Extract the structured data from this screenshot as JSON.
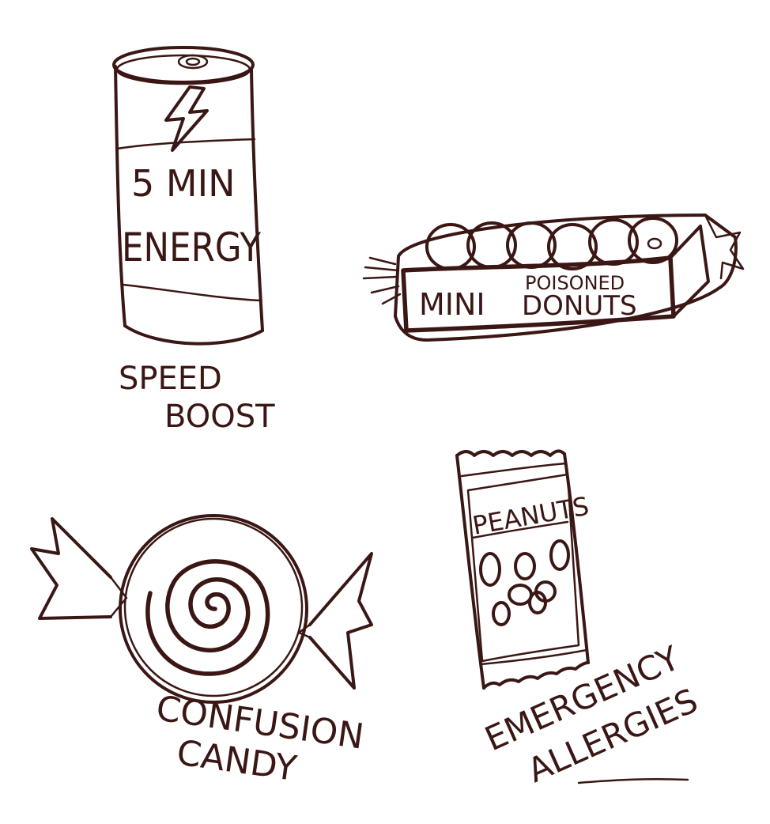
{
  "items": {
    "energy_can": {
      "can_text_line1": "5 MIN",
      "can_text_line2": "ENERGY",
      "caption_line1": "SPEED",
      "caption_line2": "BOOST"
    },
    "donuts_pack": {
      "pack_word1": "MINI",
      "pack_word2": "POISONED",
      "pack_word3": "DONUTS"
    },
    "candy": {
      "caption_line1": "CONFUSION",
      "caption_line2": "CANDY"
    },
    "peanuts_bag": {
      "bag_label": "PEANUTS",
      "caption_line1": "EMERGENCY",
      "caption_line2": "ALLERGIES"
    }
  },
  "colors": {
    "ink": "#3a1714",
    "paper": "#ffffff"
  }
}
